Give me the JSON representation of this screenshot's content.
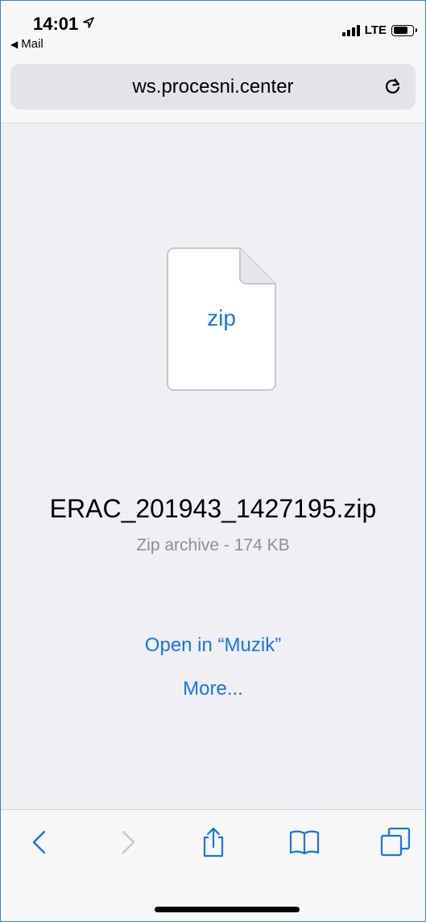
{
  "status_bar": {
    "time": "14:01",
    "back_app": "Mail",
    "network": "LTE",
    "icons": [
      "location-arrow-icon",
      "back-arrow-icon",
      "signal-icon",
      "battery-icon"
    ]
  },
  "address_bar": {
    "url": "ws.procesni.center",
    "icons": [
      "reload-icon"
    ]
  },
  "download": {
    "file_icon_label": "zip",
    "file_name": "ERAC_201943_1427195.zip",
    "file_meta": "Zip archive - 174 KB",
    "open_in_label": "Open in “Muzik”",
    "more_label": "More..."
  },
  "toolbar": {
    "items": [
      "back-icon",
      "forward-icon",
      "share-icon",
      "bookmarks-icon",
      "tabs-icon"
    ]
  },
  "colors": {
    "accent": "#1a73e8",
    "page_background": "#efeff4",
    "secondary_text": "#8e8e93"
  }
}
